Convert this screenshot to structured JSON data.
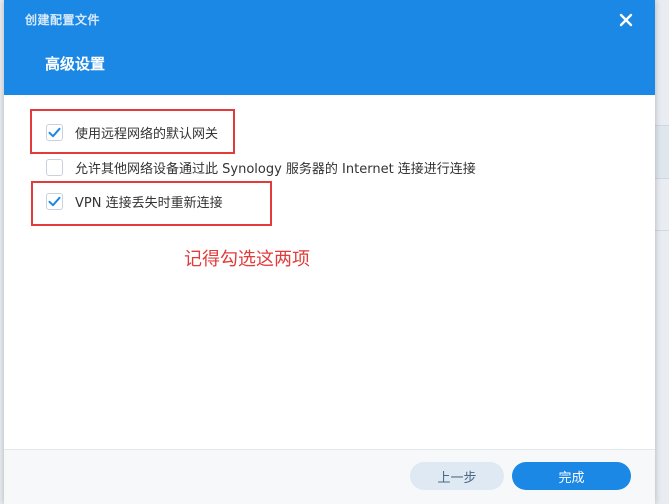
{
  "window": {
    "title": "创建配置文件"
  },
  "page": {
    "title": "高级设置"
  },
  "options": [
    {
      "label": "使用远程网络的默认网关",
      "checked": true
    },
    {
      "label": "允许其他网络设备通过此 Synology 服务器的 Internet 连接进行连接",
      "checked": false
    },
    {
      "label": "VPN 连接丢失时重新连接",
      "checked": true
    }
  ],
  "annotation": {
    "note": "记得勾选这两项",
    "color": "#e23b3b"
  },
  "footer": {
    "prev_label": "上一步",
    "done_label": "完成"
  },
  "colors": {
    "accent": "#1b88e6",
    "highlight": "#e23b3b"
  }
}
